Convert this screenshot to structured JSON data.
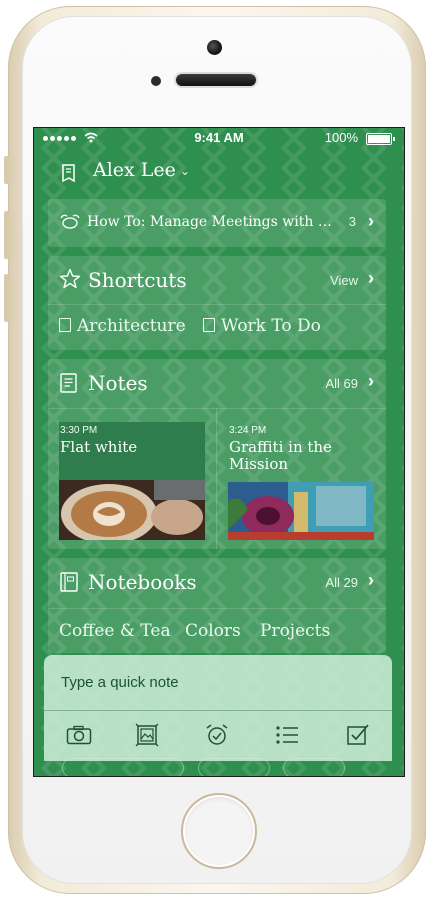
{
  "status": {
    "time": "9:41 AM",
    "battery": "100%"
  },
  "account": {
    "name": "Alex Lee"
  },
  "reminder": {
    "text": "How To: Manage Meetings with Ever...",
    "count": "3"
  },
  "shortcuts": {
    "title": "Shortcuts",
    "action": "View",
    "items": [
      "Architecture",
      "Work To Do"
    ]
  },
  "notes": {
    "title": "Notes",
    "count": "All 69",
    "items": [
      {
        "time": "3:30 PM",
        "title": "Flat white"
      },
      {
        "time": "3:24 PM",
        "title": "Graffiti in the Mission"
      }
    ]
  },
  "notebooks": {
    "title": "Notebooks",
    "count": "All 29",
    "items": [
      "Coffee & Tea",
      "Colors",
      "Projects"
    ]
  },
  "quick_note": {
    "placeholder": "Type a quick note"
  },
  "colors": {
    "screen_green": "#2e8f4f",
    "quick_note_bg": "#d6f1de"
  }
}
